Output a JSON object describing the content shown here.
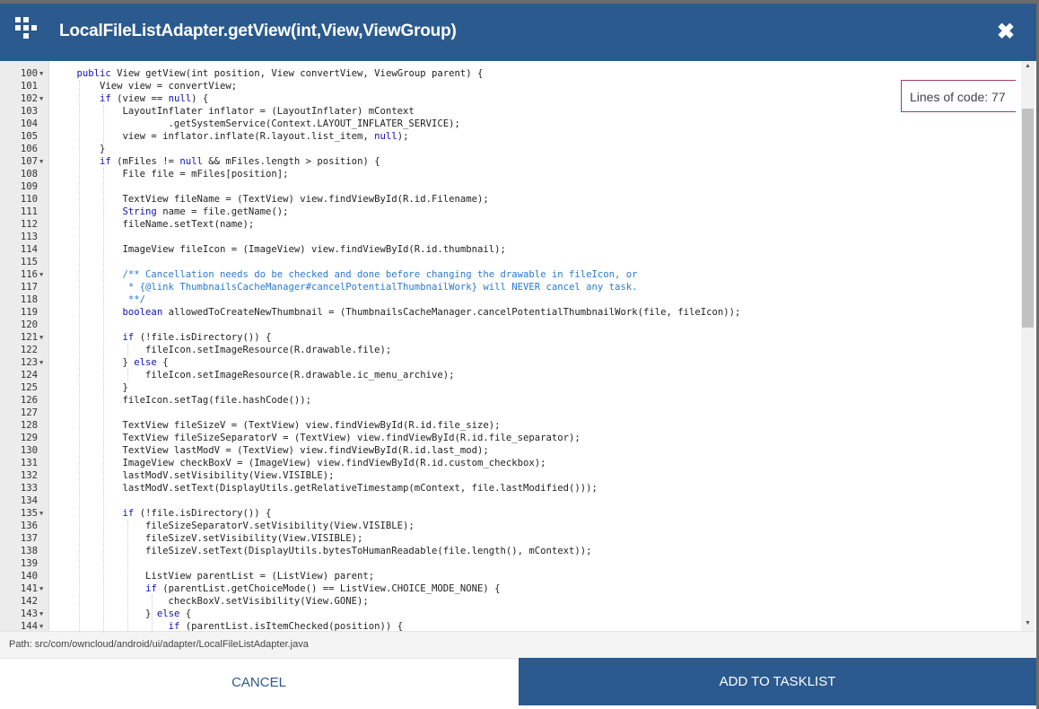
{
  "dialog": {
    "title": "LocalFileListAdapter.getView(int,View,ViewGroup)",
    "icon": "grid-app-icon",
    "close_icon": "close-icon",
    "lines_of_code_badge": "Lines of code: 77",
    "path": "Path: src/com/owncloud/android/ui/adapter/LocalFileListAdapter.java",
    "cancel_label": "CANCEL",
    "add_label": "ADD TO TASKLIST",
    "colors": {
      "header": "#2a5a8e",
      "badge_border": "#a03c6c"
    }
  },
  "code": {
    "lines": [
      {
        "n": "100",
        "fold": true,
        "text": "    public View getView(int position, View convertView, ViewGroup parent) {"
      },
      {
        "n": "101",
        "fold": false,
        "text": "        View view = convertView;"
      },
      {
        "n": "102",
        "fold": true,
        "text": "        if (view == null) {"
      },
      {
        "n": "103",
        "fold": false,
        "text": "            LayoutInflater inflator = (LayoutInflater) mContext"
      },
      {
        "n": "104",
        "fold": false,
        "text": "                    .getSystemService(Context.LAYOUT_INFLATER_SERVICE);"
      },
      {
        "n": "105",
        "fold": false,
        "text": "            view = inflator.inflate(R.layout.list_item, null);"
      },
      {
        "n": "106",
        "fold": false,
        "text": "        }"
      },
      {
        "n": "107",
        "fold": true,
        "text": "        if (mFiles != null && mFiles.length > position) {"
      },
      {
        "n": "108",
        "fold": false,
        "text": "            File file = mFiles[position];"
      },
      {
        "n": "109",
        "fold": false,
        "text": ""
      },
      {
        "n": "110",
        "fold": false,
        "text": "            TextView fileName = (TextView) view.findViewById(R.id.Filename);"
      },
      {
        "n": "111",
        "fold": false,
        "text": "            String name = file.getName();"
      },
      {
        "n": "112",
        "fold": false,
        "text": "            fileName.setText(name);"
      },
      {
        "n": "113",
        "fold": false,
        "text": ""
      },
      {
        "n": "114",
        "fold": false,
        "text": "            ImageView fileIcon = (ImageView) view.findViewById(R.id.thumbnail);"
      },
      {
        "n": "115",
        "fold": false,
        "text": ""
      },
      {
        "n": "116",
        "fold": true,
        "text": "            /** Cancellation needs do be checked and done before changing the drawable in fileIcon, or"
      },
      {
        "n": "117",
        "fold": false,
        "text": "             * {@link ThumbnailsCacheManager#cancelPotentialThumbnailWork} will NEVER cancel any task."
      },
      {
        "n": "118",
        "fold": false,
        "text": "             **/"
      },
      {
        "n": "119",
        "fold": false,
        "text": "            boolean allowedToCreateNewThumbnail = (ThumbnailsCacheManager.cancelPotentialThumbnailWork(file, fileIcon));"
      },
      {
        "n": "120",
        "fold": false,
        "text": ""
      },
      {
        "n": "121",
        "fold": true,
        "text": "            if (!file.isDirectory()) {"
      },
      {
        "n": "122",
        "fold": false,
        "text": "                fileIcon.setImageResource(R.drawable.file);"
      },
      {
        "n": "123",
        "fold": true,
        "text": "            } else {"
      },
      {
        "n": "124",
        "fold": false,
        "text": "                fileIcon.setImageResource(R.drawable.ic_menu_archive);"
      },
      {
        "n": "125",
        "fold": false,
        "text": "            }"
      },
      {
        "n": "126",
        "fold": false,
        "text": "            fileIcon.setTag(file.hashCode());"
      },
      {
        "n": "127",
        "fold": false,
        "text": ""
      },
      {
        "n": "128",
        "fold": false,
        "text": "            TextView fileSizeV = (TextView) view.findViewById(R.id.file_size);"
      },
      {
        "n": "129",
        "fold": false,
        "text": "            TextView fileSizeSeparatorV = (TextView) view.findViewById(R.id.file_separator);"
      },
      {
        "n": "130",
        "fold": false,
        "text": "            TextView lastModV = (TextView) view.findViewById(R.id.last_mod);"
      },
      {
        "n": "131",
        "fold": false,
        "text": "            ImageView checkBoxV = (ImageView) view.findViewById(R.id.custom_checkbox);"
      },
      {
        "n": "132",
        "fold": false,
        "text": "            lastModV.setVisibility(View.VISIBLE);"
      },
      {
        "n": "133",
        "fold": false,
        "text": "            lastModV.setText(DisplayUtils.getRelativeTimestamp(mContext, file.lastModified()));"
      },
      {
        "n": "134",
        "fold": false,
        "text": ""
      },
      {
        "n": "135",
        "fold": true,
        "text": "            if (!file.isDirectory()) {"
      },
      {
        "n": "136",
        "fold": false,
        "text": "                fileSizeSeparatorV.setVisibility(View.VISIBLE);"
      },
      {
        "n": "137",
        "fold": false,
        "text": "                fileSizeV.setVisibility(View.VISIBLE);"
      },
      {
        "n": "138",
        "fold": false,
        "text": "                fileSizeV.setText(DisplayUtils.bytesToHumanReadable(file.length(), mContext));"
      },
      {
        "n": "139",
        "fold": false,
        "text": ""
      },
      {
        "n": "140",
        "fold": false,
        "text": "                ListView parentList = (ListView) parent;"
      },
      {
        "n": "141",
        "fold": true,
        "text": "                if (parentList.getChoiceMode() == ListView.CHOICE_MODE_NONE) {"
      },
      {
        "n": "142",
        "fold": false,
        "text": "                    checkBoxV.setVisibility(View.GONE);"
      },
      {
        "n": "143",
        "fold": true,
        "text": "                } else {"
      },
      {
        "n": "144",
        "fold": true,
        "text": "                    if (parentList.isItemChecked(position)) {"
      }
    ]
  }
}
